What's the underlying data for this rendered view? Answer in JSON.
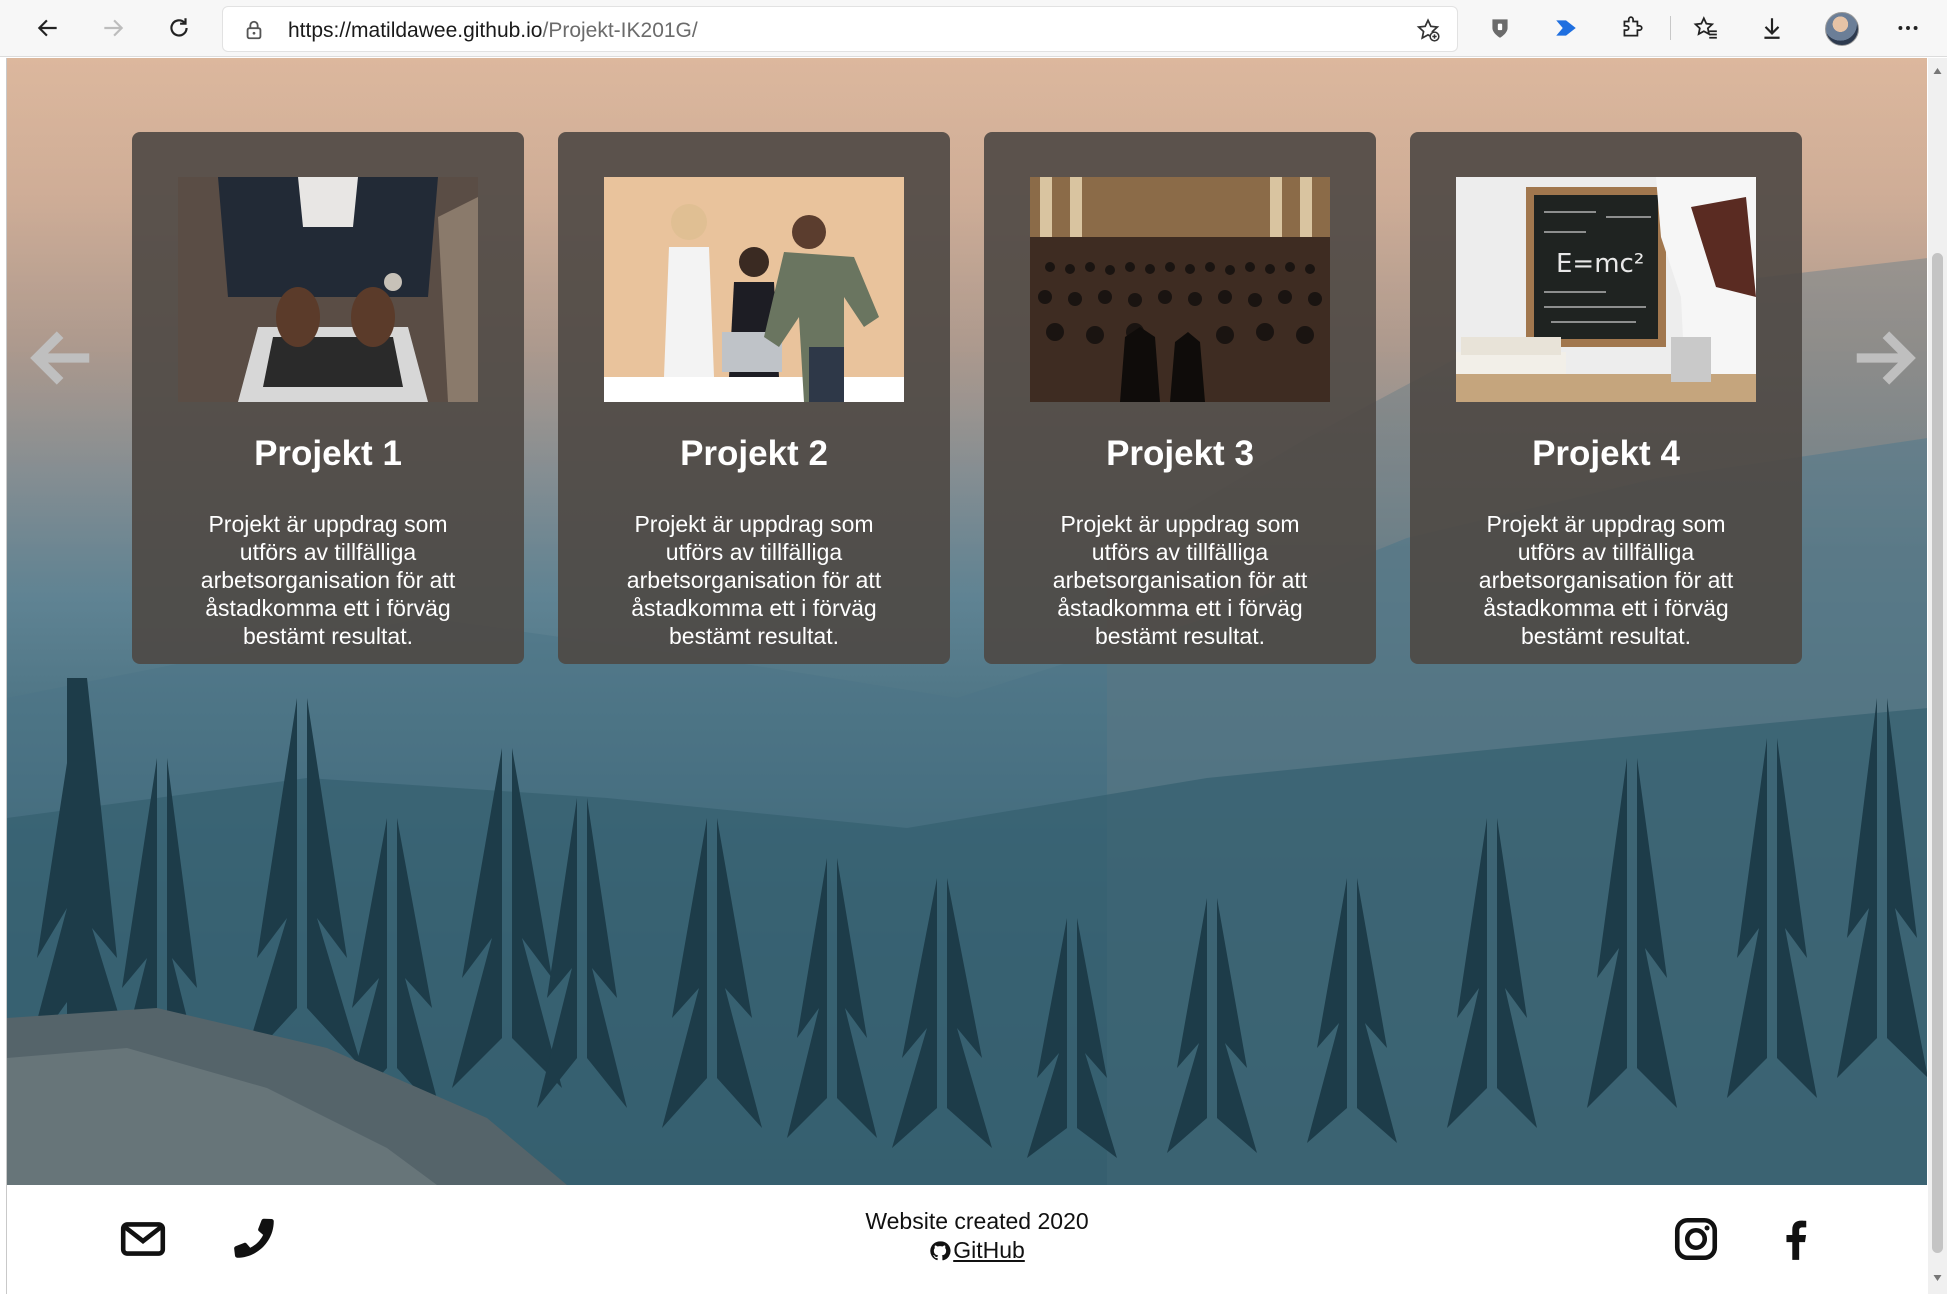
{
  "browser": {
    "url_host": "https://matildawee.github.io",
    "url_path": "/Projekt-IK201G/",
    "icons": {
      "back": "back-arrow-icon",
      "forward": "forward-arrow-icon",
      "refresh": "refresh-icon",
      "lock": "lock-icon",
      "favorite": "add-favorite-icon",
      "shield": "shield-extension-icon",
      "send": "send-extension-icon",
      "extensions": "puzzle-icon",
      "favorites": "favorites-icon",
      "downloads": "download-icon",
      "profile": "avatar",
      "menu": "more-icon"
    }
  },
  "projects": [
    {
      "title": "Projekt 1",
      "description": "Projekt är uppdrag som utförs av tillfälliga arbetsorganisation för att åstadkomma ett i förväg bestämt resultat.",
      "image": "laptop-typing"
    },
    {
      "title": "Projekt 2",
      "description": "Projekt är uppdrag som utförs av tillfälliga arbetsorganisation för att åstadkomma ett i förväg bestämt resultat.",
      "image": "team-at-laptop"
    },
    {
      "title": "Projekt 3",
      "description": "Projekt är uppdrag som utförs av tillfälliga arbetsorganisation för att åstadkomma ett i förväg bestämt resultat.",
      "image": "lecture-hall"
    },
    {
      "title": "Projekt 4",
      "description": "Projekt är uppdrag som utförs av tillfälliga arbetsorganisation för att åstadkomma ett i förväg bestämt resultat.",
      "image": "chalkboard-emc2"
    }
  ],
  "carousel": {
    "prev_icon": "arrow-left-icon",
    "next_icon": "arrow-right-icon"
  },
  "footer": {
    "created": "Website created 2020",
    "github_label": "GitHub",
    "icons": [
      "envelope-icon",
      "phone-icon",
      "instagram-icon",
      "facebook-icon"
    ]
  },
  "colors": {
    "card_bg": "#4e4844",
    "text_light": "#ffffff",
    "sky_top": "#d6ab8c",
    "forest": "#234756"
  }
}
